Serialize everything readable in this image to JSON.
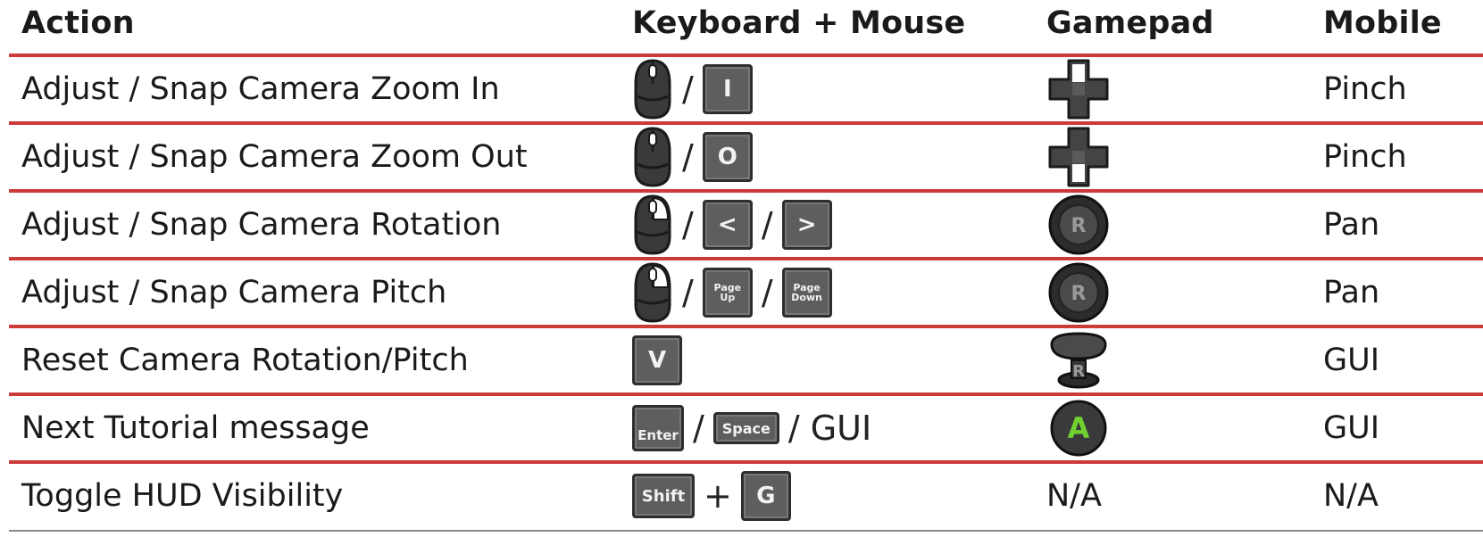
{
  "headers": {
    "action": "Action",
    "keyboard": "Keyboard + Mouse",
    "gamepad": "Gamepad",
    "mobile": "Mobile"
  },
  "rows": [
    {
      "action": "Adjust / Snap Camera Zoom In",
      "keys": [
        {
          "type": "mouse",
          "part": "wheel"
        },
        {
          "type": "sep",
          "text": "/"
        },
        {
          "type": "key",
          "text": "I"
        }
      ],
      "gamepad": {
        "type": "dpad",
        "highlight": "up"
      },
      "mobile": "Pinch"
    },
    {
      "action": "Adjust / Snap Camera Zoom Out",
      "keys": [
        {
          "type": "mouse",
          "part": "wheel"
        },
        {
          "type": "sep",
          "text": "/"
        },
        {
          "type": "key",
          "text": "O"
        }
      ],
      "gamepad": {
        "type": "dpad",
        "highlight": "down"
      },
      "mobile": "Pinch"
    },
    {
      "action": "Adjust / Snap Camera Rotation",
      "keys": [
        {
          "type": "mouse",
          "part": "right"
        },
        {
          "type": "sep",
          "text": "/"
        },
        {
          "type": "key",
          "text": "<"
        },
        {
          "type": "sep",
          "text": "/"
        },
        {
          "type": "key",
          "text": ">"
        }
      ],
      "gamepad": {
        "type": "stick",
        "text": "R"
      },
      "mobile": "Pan"
    },
    {
      "action": "Adjust / Snap Camera Pitch",
      "keys": [
        {
          "type": "mouse",
          "part": "right"
        },
        {
          "type": "sep",
          "text": "/"
        },
        {
          "type": "key",
          "text": "Page Up",
          "small": true
        },
        {
          "type": "sep",
          "text": "/"
        },
        {
          "type": "key",
          "text": "Page Down",
          "small": true
        }
      ],
      "gamepad": {
        "type": "stick",
        "text": "R"
      },
      "mobile": "Pan"
    },
    {
      "action": "Reset Camera Rotation/Pitch",
      "keys": [
        {
          "type": "key",
          "text": "V"
        }
      ],
      "gamepad": {
        "type": "stick-press",
        "text": "R"
      },
      "mobile": "GUI"
    },
    {
      "action": "Next Tutorial message",
      "keys": [
        {
          "type": "key",
          "text": "Enter",
          "enter": true
        },
        {
          "type": "sep",
          "text": "/"
        },
        {
          "type": "key",
          "text": "Space",
          "space": true
        },
        {
          "type": "sep",
          "text": "/ GUI"
        }
      ],
      "gamepad": {
        "type": "button",
        "text": "A",
        "color": "#6fd230"
      },
      "mobile": "GUI"
    },
    {
      "action": "Toggle HUD Visibility",
      "keys": [
        {
          "type": "key",
          "text": "Shift",
          "shift": true
        },
        {
          "type": "sep",
          "text": "+"
        },
        {
          "type": "key",
          "text": "G"
        }
      ],
      "gamepad": {
        "type": "text",
        "text": "N/A"
      },
      "mobile": "N/A"
    }
  ],
  "colors": {
    "rule": "#cc3a3a",
    "key_fill": "#5e5e5e",
    "key_border": "#2e2e2e",
    "a_button": "#6fd230"
  }
}
